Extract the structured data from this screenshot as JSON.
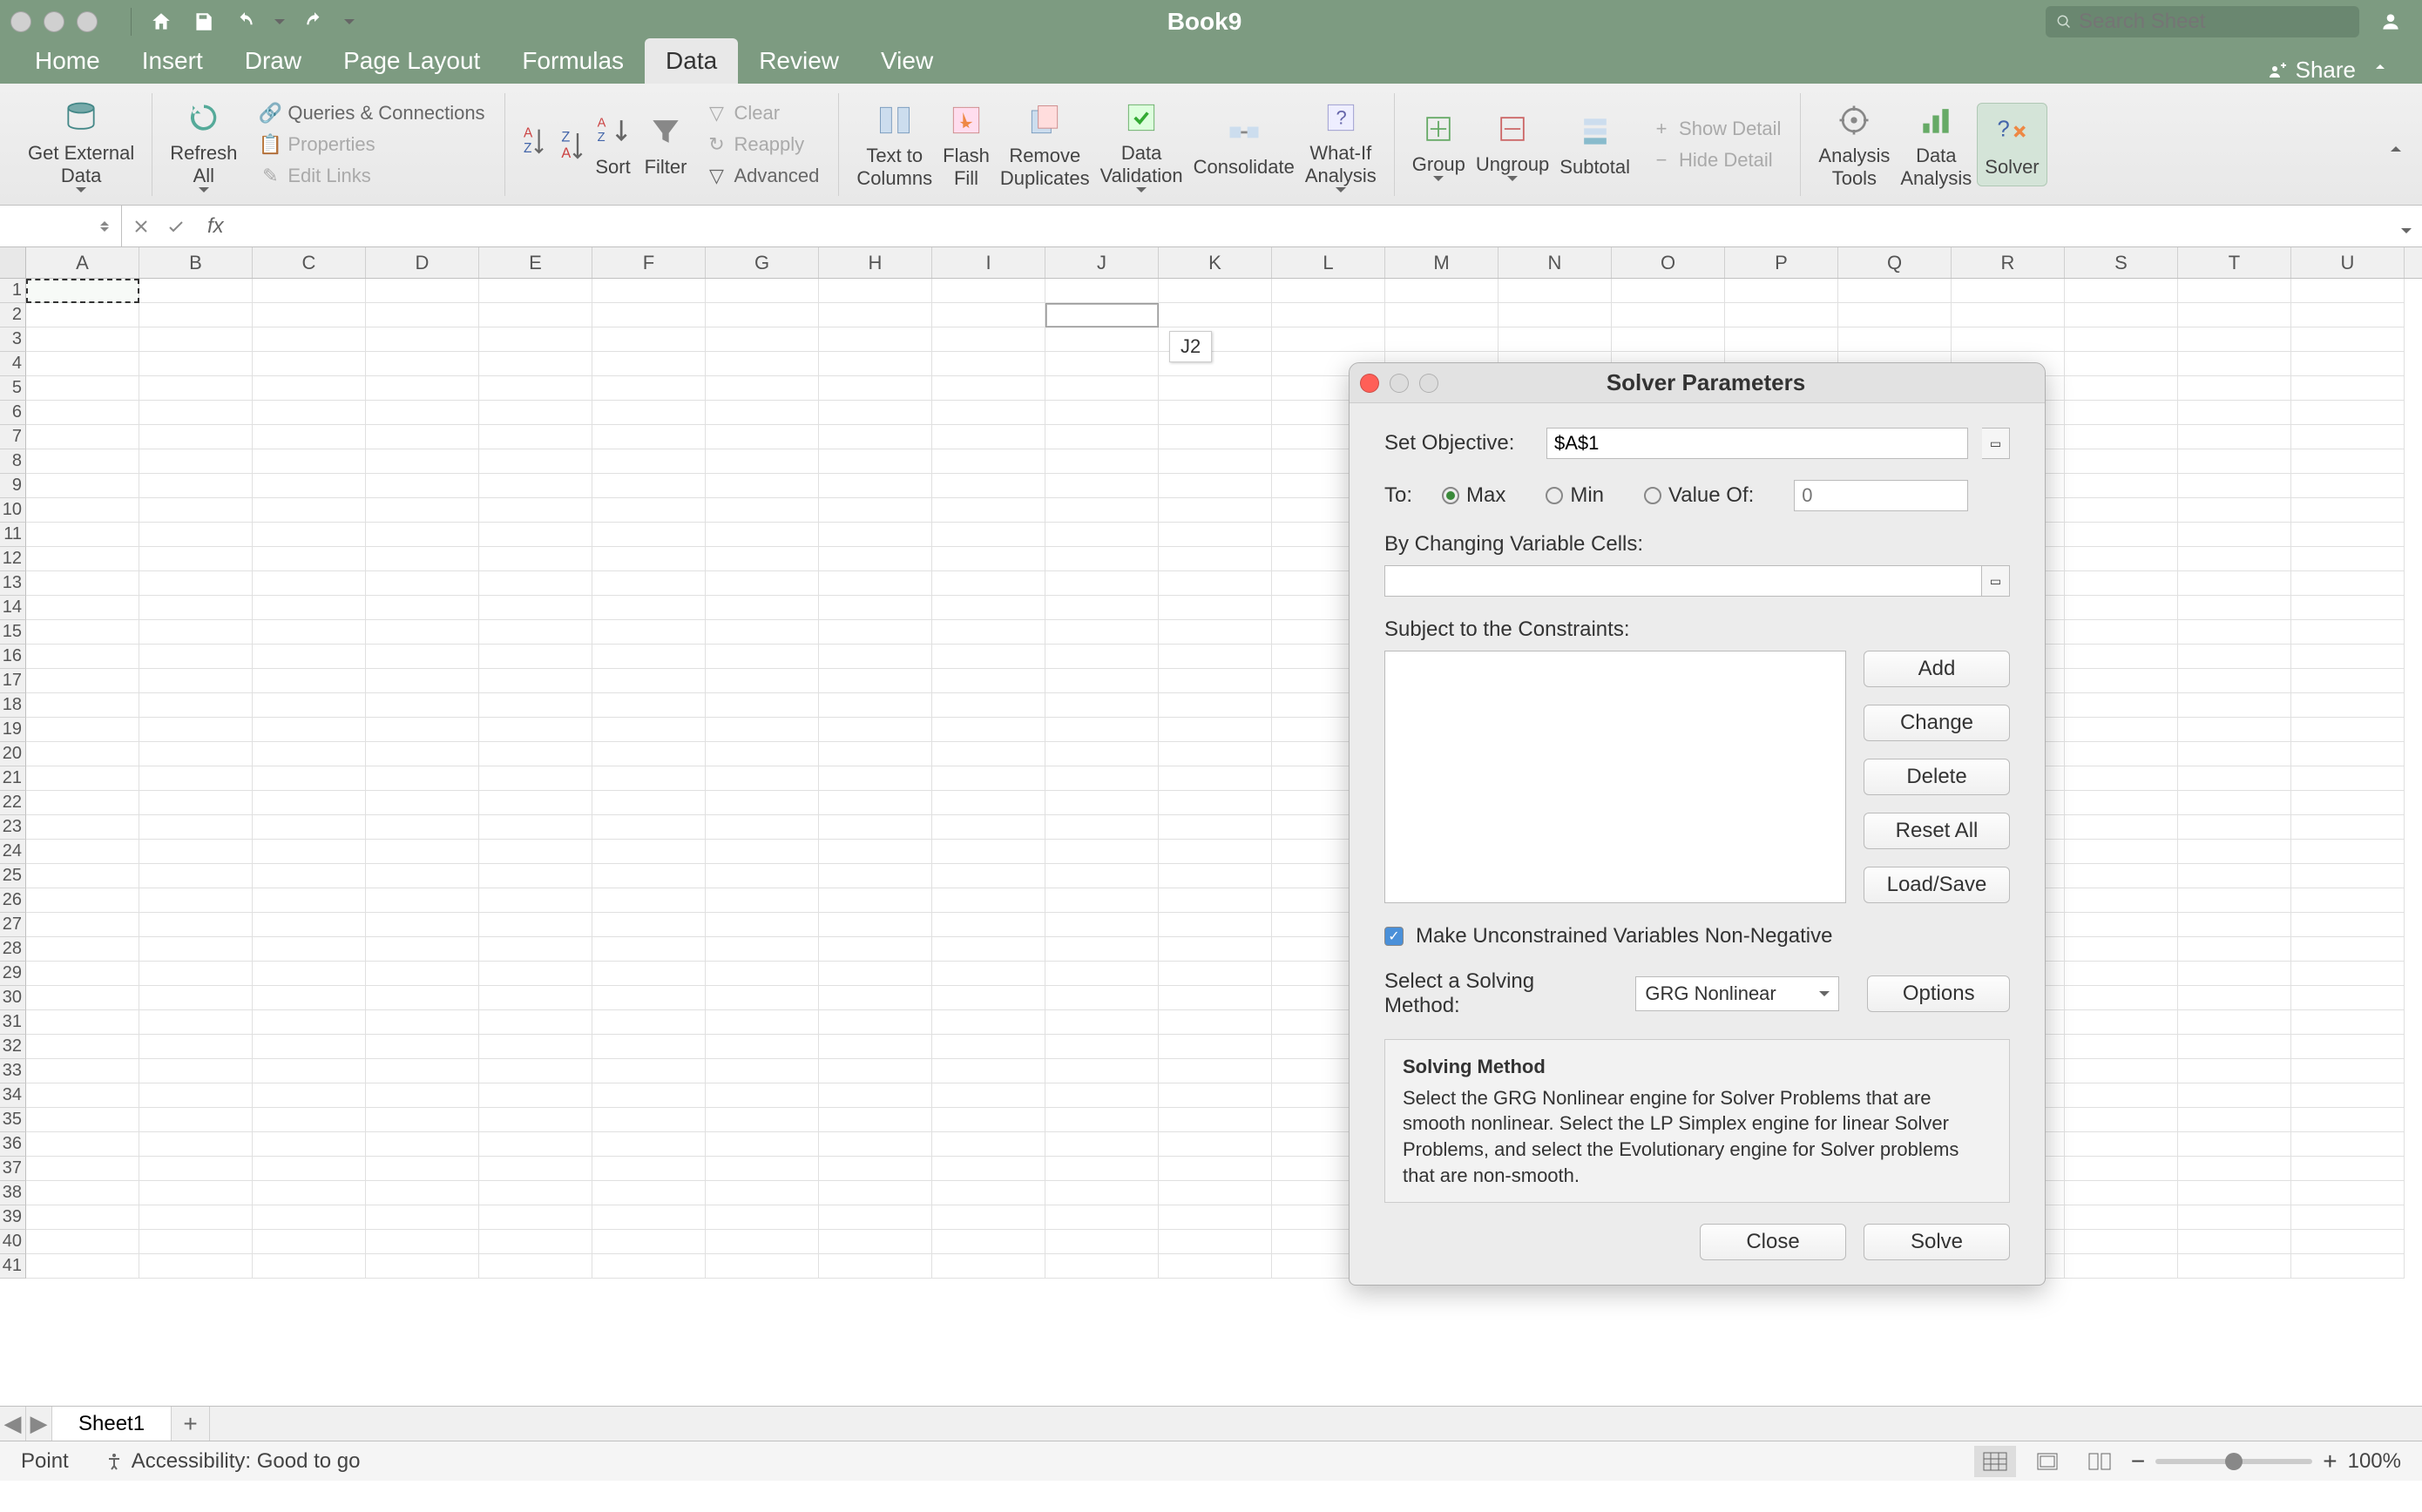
{
  "titleBar": {
    "docTitle": "Book9",
    "searchPlaceholder": "Search Sheet"
  },
  "menuTabs": [
    "Home",
    "Insert",
    "Draw",
    "Page Layout",
    "Formulas",
    "Data",
    "Review",
    "View"
  ],
  "activeTab": "Data",
  "share": "Share",
  "ribbon": {
    "getExternalData": "Get External\nData",
    "refreshAll": "Refresh\nAll",
    "queries": "Queries & Connections",
    "properties": "Properties",
    "editLinks": "Edit Links",
    "sort": "Sort",
    "filter": "Filter",
    "clear": "Clear",
    "reapply": "Reapply",
    "advanced": "Advanced",
    "textToColumns": "Text to\nColumns",
    "flashFill": "Flash\nFill",
    "removeDuplicates": "Remove\nDuplicates",
    "dataValidation": "Data\nValidation",
    "consolidate": "Consolidate",
    "whatIf": "What-If\nAnalysis",
    "group": "Group",
    "ungroup": "Ungroup",
    "subtotal": "Subtotal",
    "showDetail": "Show Detail",
    "hideDetail": "Hide Detail",
    "analysisTools": "Analysis\nTools",
    "dataAnalysis": "Data\nAnalysis",
    "solver": "Solver"
  },
  "formulaBar": {
    "nameBox": ""
  },
  "columns": [
    "A",
    "B",
    "C",
    "D",
    "E",
    "F",
    "G",
    "H",
    "I",
    "J",
    "K",
    "L",
    "M",
    "N",
    "O",
    "P",
    "Q",
    "R",
    "S",
    "T",
    "U"
  ],
  "rowCount": 41,
  "cellTooltip": "J2",
  "sheetTabs": [
    "Sheet1"
  ],
  "statusBar": {
    "mode": "Point",
    "accessibility": "Accessibility: Good to go",
    "zoom": "100%"
  },
  "solver": {
    "title": "Solver Parameters",
    "setObjectiveLabel": "Set Objective:",
    "setObjectiveValue": "$A$1",
    "toLabel": "To:",
    "max": "Max",
    "min": "Min",
    "valueOf": "Value Of:",
    "valueOfPlaceholder": "0",
    "byChangingLabel": "By Changing Variable Cells:",
    "constraintsLabel": "Subject to the Constraints:",
    "addBtn": "Add",
    "changeBtn": "Change",
    "deleteBtn": "Delete",
    "resetBtn": "Reset All",
    "loadSaveBtn": "Load/Save",
    "nonNegative": "Make Unconstrained Variables Non-Negative",
    "selectMethodLabel": "Select a Solving Method:",
    "selectedMethod": "GRG Nonlinear",
    "optionsBtn": "Options",
    "methodHeading": "Solving Method",
    "methodDesc": "Select the GRG Nonlinear engine for Solver Problems that are smooth nonlinear. Select the LP Simplex engine for linear Solver Problems, and select the Evolutionary engine for Solver problems that are non-smooth.",
    "closeBtn": "Close",
    "solveBtn": "Solve"
  }
}
